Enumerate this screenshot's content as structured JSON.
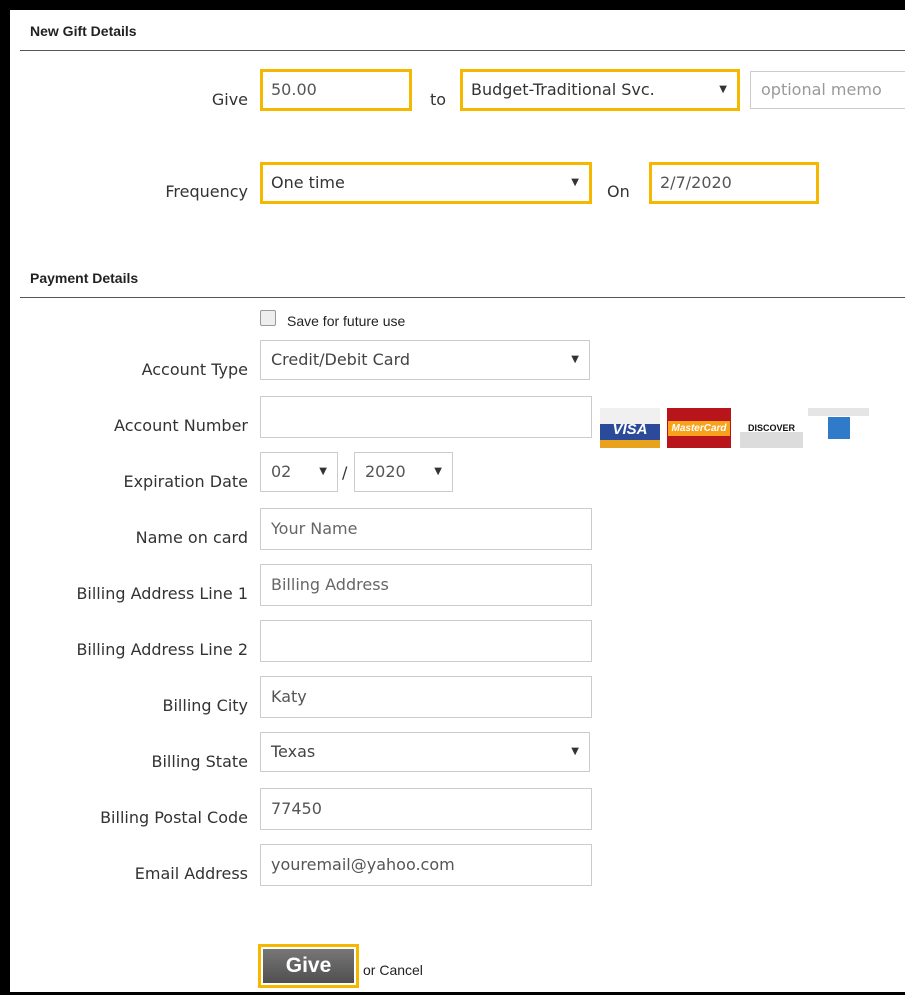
{
  "gift": {
    "section_title": "New Gift Details",
    "give_label": "Give",
    "amount": "50.00",
    "to_label": "to",
    "fund": "Budget-Traditional Svc.",
    "memo_placeholder": "optional memo",
    "frequency_label": "Frequency",
    "frequency": "One time",
    "on_label": "On",
    "date": "2/7/2020"
  },
  "payment": {
    "section_title": "Payment Details",
    "save_label": "Save for future use",
    "account_type_label": "Account Type",
    "account_type": "Credit/Debit Card",
    "account_number_label": "Account Number",
    "cards": [
      "VISA",
      "MasterCard",
      "DISCOVER",
      "AmEx"
    ],
    "expiration_label": "Expiration Date",
    "exp_month": "02",
    "exp_sep": "/",
    "exp_year": "2020",
    "name_label": "Name on card",
    "name_placeholder": "Your Name",
    "addr1_label": "Billing Address Line 1",
    "addr1_placeholder": "Billing Address",
    "addr2_label": "Billing Address Line 2",
    "city_label": "Billing City",
    "city": "Katy",
    "state_label": "Billing State",
    "state": "Texas",
    "postal_label": "Billing Postal Code",
    "postal": "77450",
    "email_label": "Email Address",
    "email": "youremail@yahoo.com"
  },
  "actions": {
    "give_button": "Give",
    "cancel_text": "or Cancel"
  },
  "colors": {
    "highlight": "#f5b700",
    "button_bg": "#5f5f5f"
  }
}
